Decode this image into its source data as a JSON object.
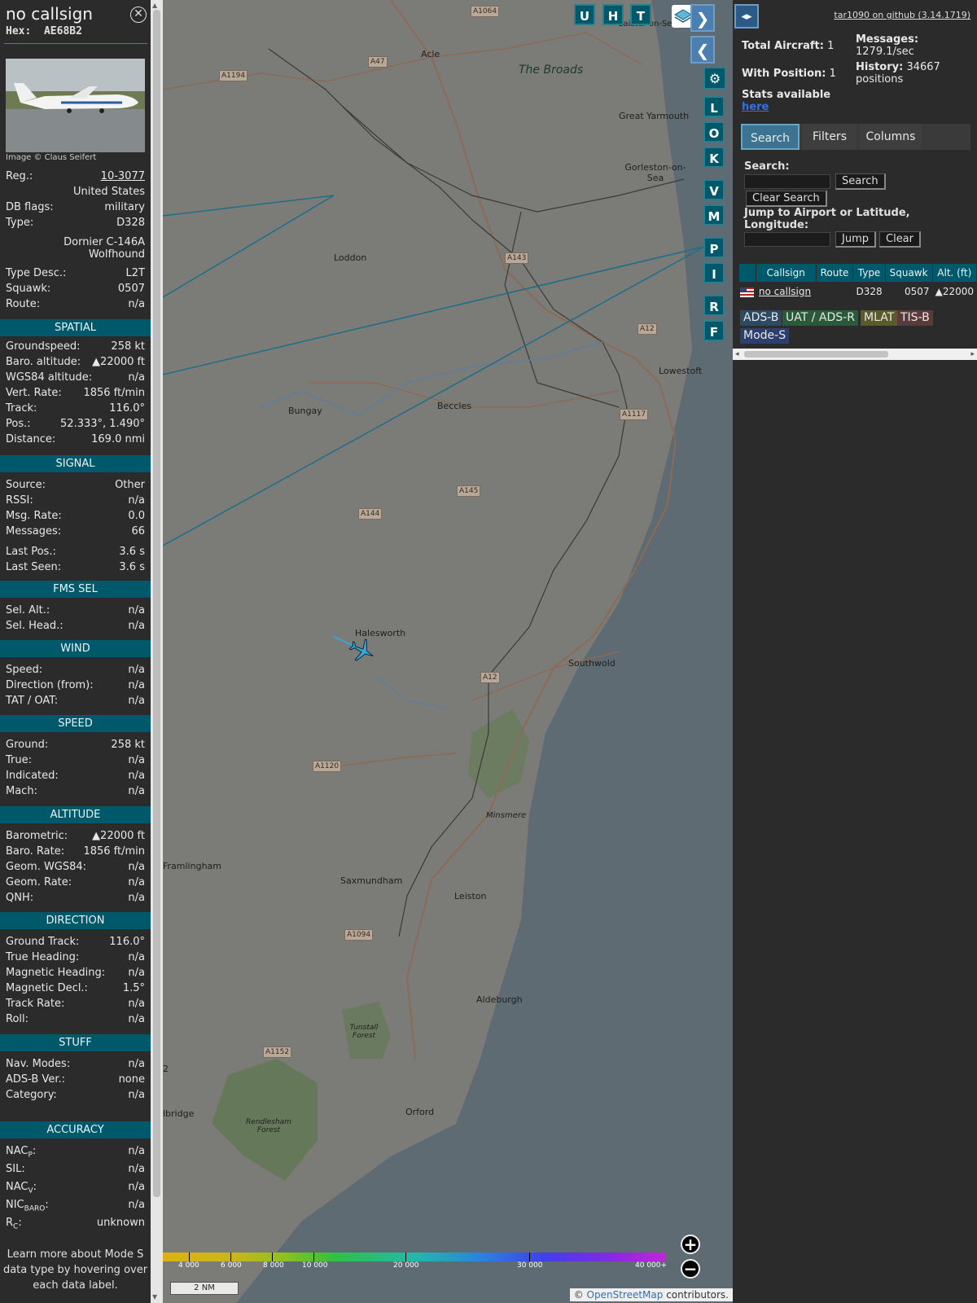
{
  "sidebar": {
    "title": "no callsign",
    "hex_label": "Hex:",
    "hex": "AE68B2",
    "photo_credit": "Image © Claus Seifert",
    "reg_label": "Reg.:",
    "reg": "10-3077",
    "country": "United States",
    "db_flags_label": "DB flags:",
    "db_flags": "military",
    "type_label": "Type:",
    "type": "D328",
    "model_line1": "Dornier C-146A",
    "model_line2": "Wolfhound",
    "type_desc_label": "Type Desc.:",
    "type_desc": "L2T",
    "squawk_label": "Squawk:",
    "squawk": "0507",
    "route_label": "Route:",
    "route": "n/a",
    "sections": {
      "spatial": "SPATIAL",
      "signal": "SIGNAL",
      "fms": "FMS SEL",
      "wind": "WIND",
      "speed": "SPEED",
      "altitude": "ALTITUDE",
      "direction": "DIRECTION",
      "stuff": "STUFF",
      "accuracy": "ACCURACY"
    },
    "spatial": [
      {
        "k": "Groundspeed:",
        "v": "258 kt"
      },
      {
        "k": "Baro. altitude:",
        "v": "▲22000 ft"
      },
      {
        "k": "WGS84 altitude:",
        "v": "n/a"
      },
      {
        "k": "Vert. Rate:",
        "v": "1856 ft/min"
      },
      {
        "k": "Track:",
        "v": "116.0°"
      },
      {
        "k": "Pos.:",
        "v": "52.333°, 1.490°"
      },
      {
        "k": "Distance:",
        "v": "169.0 nmi"
      }
    ],
    "signal": [
      {
        "k": "Source:",
        "v": "Other"
      },
      {
        "k": "RSSI:",
        "v": "n/a"
      },
      {
        "k": "Msg. Rate:",
        "v": "0.0"
      },
      {
        "k": "Messages:",
        "v": "66"
      },
      {
        "k": "Last Pos.:",
        "v": "3.6 s"
      },
      {
        "k": "Last Seen:",
        "v": "3.6 s"
      }
    ],
    "fms": [
      {
        "k": "Sel. Alt.:",
        "v": "n/a"
      },
      {
        "k": "Sel. Head.:",
        "v": "n/a"
      }
    ],
    "wind": [
      {
        "k": "Speed:",
        "v": "n/a"
      },
      {
        "k": "Direction (from):",
        "v": "n/a"
      },
      {
        "k": "TAT / OAT:",
        "v": "n/a"
      }
    ],
    "speed": [
      {
        "k": "Ground:",
        "v": "258 kt"
      },
      {
        "k": "True:",
        "v": "n/a"
      },
      {
        "k": "Indicated:",
        "v": "n/a"
      },
      {
        "k": "Mach:",
        "v": "n/a"
      }
    ],
    "altitude": [
      {
        "k": "Barometric:",
        "v": "▲22000 ft"
      },
      {
        "k": "Baro. Rate:",
        "v": "1856 ft/min"
      },
      {
        "k": "Geom. WGS84:",
        "v": "n/a"
      },
      {
        "k": "Geom. Rate:",
        "v": "n/a"
      },
      {
        "k": "QNH:",
        "v": "n/a"
      }
    ],
    "direction": [
      {
        "k": "Ground Track:",
        "v": "116.0°"
      },
      {
        "k": "True Heading:",
        "v": "n/a"
      },
      {
        "k": "Magnetic Heading:",
        "v": "n/a"
      },
      {
        "k": "Magnetic Decl.:",
        "v": "1.5°"
      },
      {
        "k": "Track Rate:",
        "v": "n/a"
      },
      {
        "k": "Roll:",
        "v": "n/a"
      }
    ],
    "stuff": [
      {
        "k": "Nav. Modes:",
        "v": "n/a"
      },
      {
        "k": "ADS-B Ver.:",
        "v": "none"
      },
      {
        "k": "Category:",
        "v": "n/a"
      }
    ],
    "accuracy": [
      {
        "k": "NAC",
        "sub": "P",
        "v": "n/a"
      },
      {
        "k": "SIL:",
        "sub": "",
        "v": "n/a"
      },
      {
        "k": "NAC",
        "sub": "V",
        "v": "n/a"
      },
      {
        "k": "NIC",
        "sub": "BARO",
        "v": "n/a"
      },
      {
        "k": "R",
        "sub": "C",
        "v": "unknown"
      }
    ],
    "footer": "Learn more about Mode S data type by hovering over each data label."
  },
  "map": {
    "top_buttons": [
      "U",
      "H",
      "T"
    ],
    "side_buttons": [
      "L",
      "O",
      "K",
      "V",
      "M",
      "P",
      "I",
      "R",
      "F"
    ],
    "places": [
      "The Broads",
      "Acle",
      "Great Yarmouth",
      "Gorleston-on-Sea",
      "Loddon",
      "Lowestoft",
      "Bungay",
      "Beccles",
      "Halesworth",
      "Southwold",
      "Minsmere",
      "Framlingham",
      "Saxmundham",
      "Leiston",
      "Aldeburgh",
      "Tunstall Forest",
      "Orford",
      "Rendlesham Forest",
      "Caister-on-Sea",
      "lbridge",
      "2"
    ],
    "roads": [
      "A1064",
      "A47",
      "A1194",
      "A143",
      "A12",
      "A1117",
      "A145",
      "A144",
      "A12",
      "A1120",
      "A1094",
      "A1152"
    ],
    "colorbar_ticks": [
      "4 000",
      "6 000",
      "8 000",
      "10 000",
      "20 000",
      "30 000",
      "40 000+"
    ],
    "scale": "2 NM",
    "attribution_prefix": "© ",
    "attribution_link": "OpenStreetMap",
    "attribution_suffix": " contributors."
  },
  "panel": {
    "github": "tar1090 on github (3.14.1719)",
    "total_label": "Total Aircraft:",
    "total": "1",
    "messages_label": "Messages:",
    "messages": "1279.1/sec",
    "withpos_label": "With Position:",
    "withpos": "1",
    "history_label": "History:",
    "history": "34667",
    "history_unit": "positions",
    "stats_label": "Stats available",
    "stats_link": "here",
    "tabs": [
      "Search",
      "Filters",
      "Columns"
    ],
    "search_label": "Search:",
    "search_btn": "Search",
    "clear_search_btn": "Clear Search",
    "jump_label": "Jump to Airport or Latitude, Longitude:",
    "jump_btn": "Jump",
    "clear_btn": "Clear",
    "table_headers": [
      "Callsign",
      "Route",
      "Type",
      "Squawk",
      "Alt. (ft)"
    ],
    "table_rows": [
      {
        "callsign": "no callsign",
        "route": "",
        "type": "D328",
        "squawk": "0507",
        "alt": "▲22000"
      }
    ],
    "chips": [
      {
        "label": "ADS-B",
        "color": "#2d4a63"
      },
      {
        "label": "UAT / ADS-R",
        "color": "#2a5a3a"
      },
      {
        "label": "MLAT",
        "color": "#5a5a2a"
      },
      {
        "label": "TIS-B",
        "color": "#5a3a3a"
      },
      {
        "label": "Mode-S",
        "color": "#2d3f6e"
      }
    ]
  },
  "colors": {
    "accent": "#00596b",
    "aircraft": "#3aa7d8"
  }
}
